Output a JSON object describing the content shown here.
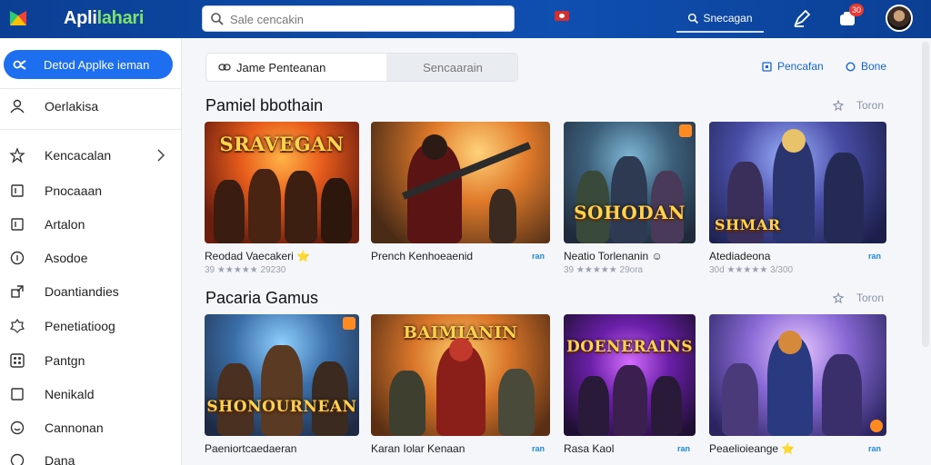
{
  "header": {
    "app_name_part1": "Apli",
    "app_name_part2": "lahari",
    "search_placeholder": "Sale cencakin",
    "search_button": "Snecagan",
    "notification_count": "30"
  },
  "sidebar": {
    "active_item": "Detod Applke ieman",
    "items": [
      {
        "label": "Oerlakisa",
        "icon": "user-icon"
      },
      {
        "label": "Kencacalan",
        "icon": "star-icon"
      },
      {
        "label": "Pnocaaan",
        "icon": "square-icon"
      },
      {
        "label": "Artalon",
        "icon": "square-icon"
      },
      {
        "label": "Asodoe",
        "icon": "info-icon"
      },
      {
        "label": "Doantiandies",
        "icon": "external-icon"
      },
      {
        "label": "Penetiatioog",
        "icon": "badge-icon"
      },
      {
        "label": "Pantgn",
        "icon": "grid-icon"
      },
      {
        "label": "Nenikald",
        "icon": "square-icon"
      },
      {
        "label": "Cannonan",
        "icon": "smile-icon"
      },
      {
        "label": "Dana",
        "icon": "circle-icon"
      }
    ]
  },
  "main": {
    "tabs": [
      {
        "label": "Jame Penteanan"
      },
      {
        "label": "Sencaarain"
      }
    ],
    "links": [
      {
        "label": "Pencafan"
      },
      {
        "label": "Bone"
      }
    ],
    "sections": [
      {
        "title": "Pamiel bbothain",
        "link": "Toron",
        "cards": [
          {
            "title": "Reodad Vaecakeri ⭐",
            "sub": "39 ★★★★★ 29230",
            "price": "",
            "art": "SRAVEGAN"
          },
          {
            "title": "Prench Kenhoeaenid",
            "sub": "",
            "price": "ran",
            "art": ""
          },
          {
            "title": "Neatio Torlenanin ☺",
            "sub": "39 ★★★★★ 29ora",
            "price": "",
            "art": "SOHODAN"
          },
          {
            "title": "Atediadeona",
            "sub": "30d ★★★★★ 3/300",
            "price": "ran",
            "art": "SHMAR"
          }
        ]
      },
      {
        "title": "Pacaria Gamus",
        "link": "Toron",
        "cards": [
          {
            "title": "Paeniortcaedaeran",
            "sub": "",
            "price": "",
            "art": "SHONOURNEAN"
          },
          {
            "title": "Karan Iolar Kenaan",
            "sub": "",
            "price": "ran",
            "art": "BAIMIANIN"
          },
          {
            "title": "Rasa Kaol",
            "sub": "",
            "price": "ran",
            "art": "DOENERAINS"
          },
          {
            "title": "Peaelioieange ⭐",
            "sub": "",
            "price": "ran",
            "art": ""
          }
        ]
      }
    ]
  },
  "colors": {
    "topbar": "#0b3f94",
    "accent": "#1e6ff0",
    "logo_green": "#7ee36b"
  }
}
